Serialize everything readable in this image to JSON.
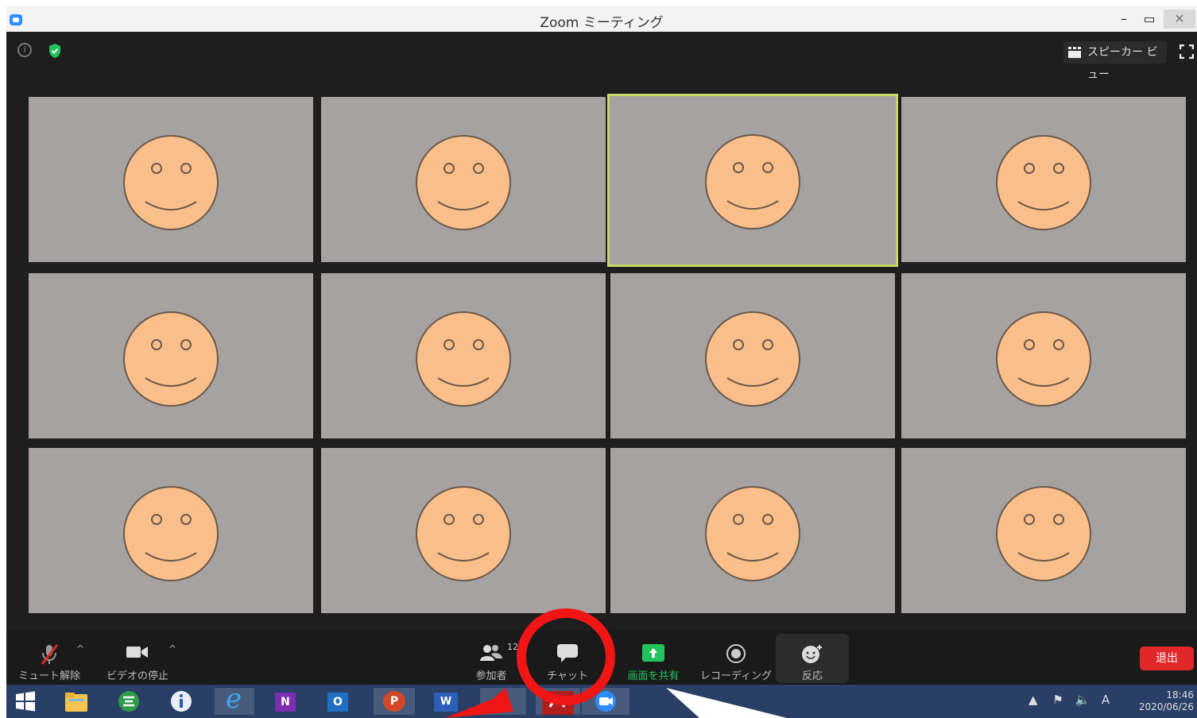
{
  "window": {
    "title": "Zoom ミーティング",
    "minimize_symbol": "–",
    "maximize_symbol": "▭",
    "close_symbol": "✕"
  },
  "header": {
    "speaker_view_label": "スピーカー ビュー",
    "info_symbol": "i"
  },
  "participants_grid": {
    "columns": 4,
    "rows": 3,
    "active_tile_index": 2,
    "tile_count": 12
  },
  "toolbar": {
    "mute_label": "ミュート解除",
    "video_label": "ビデオの停止",
    "participants_label": "参加者",
    "participants_count": "12",
    "chat_label": "チャット",
    "share_label": "画面を共有",
    "record_label": "レコーディング",
    "reaction_label": "反応",
    "leave_label": "退出",
    "caret_symbol": "^"
  },
  "taskbar": {
    "ime_indicator": "A",
    "time": "18:46",
    "date": "2020/06/26",
    "app_letters": {
      "onenote": "N",
      "outlook": "O",
      "powerpoint": "P",
      "word": "W",
      "ie": "e"
    }
  },
  "colors": {
    "tile_bg": "#a5a2a1",
    "face": "#fbbf8c",
    "active_border": "#c8d865",
    "leave_red": "#e02828",
    "share_green": "#22c35e",
    "annotation_red": "#f01616"
  }
}
